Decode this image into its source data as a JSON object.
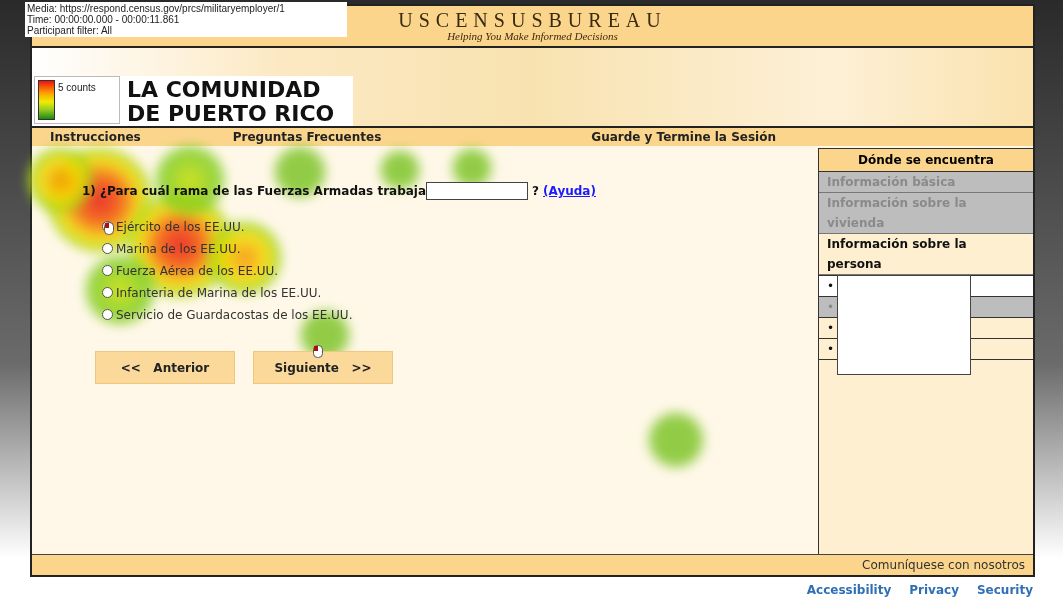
{
  "overlay_info": {
    "lines": [
      "Media: https://respond.census.gov/prcs/militaryemployer/1",
      "Time: 00:00:00.000 - 00:00:11.861",
      "Participant filter: All"
    ]
  },
  "legend": {
    "label": "5 counts"
  },
  "header": {
    "title": "USCENSUSBUREAU",
    "tagline": "Helping You Make Informed Decisions"
  },
  "banner": {
    "title_lines": [
      "LA COMUNIDAD",
      "DE PUERTO RICO"
    ]
  },
  "nav": [
    {
      "label": "Instrucciones"
    },
    {
      "label": "Preguntas Frecuentes"
    },
    {
      "label": "Guarde y Termine la Sesión"
    }
  ],
  "question": {
    "text": "1) ¿Para cuál rama de las Fuerzas Armadas trabaja",
    "mark": "?",
    "help_link": "(Ayuda)"
  },
  "options": [
    {
      "label": "Ejército de los EE.UU.",
      "selected": false
    },
    {
      "label": "Marina de los EE.UU.",
      "selected": false
    },
    {
      "label": "Fuerza Aérea de los EE.UU.",
      "selected": false
    },
    {
      "label": "Infanteria de Marina de los EE.UU.",
      "selected": false
    },
    {
      "label": "Servicio de Guardacostas de los EE.UU.",
      "selected": false
    }
  ],
  "buttons": [
    {
      "label": "<<   Anterior"
    },
    {
      "label": "Siguiente   >>"
    }
  ],
  "sidebar": {
    "title": "Dónde se encuentra",
    "sections": [
      {
        "label": "Información básica",
        "completed": true,
        "selected": false
      },
      {
        "label": "Información sobre la vivienda",
        "completed": true,
        "selected": false
      },
      {
        "label": "Información sobre la persona",
        "completed": false,
        "selected": true
      }
    ],
    "sub_items": [
      {
        "bullet": "•",
        "completed": false,
        "selected": true
      },
      {
        "bullet": "•",
        "completed": true,
        "selected": false
      },
      {
        "bullet": "•",
        "completed": false,
        "selected": false
      },
      {
        "bullet": "•",
        "completed": false,
        "selected": false
      }
    ]
  },
  "footer": {
    "contact": "Comuníquese con nosotros",
    "links": [
      "Accessibility",
      "Privacy",
      "Security"
    ]
  }
}
